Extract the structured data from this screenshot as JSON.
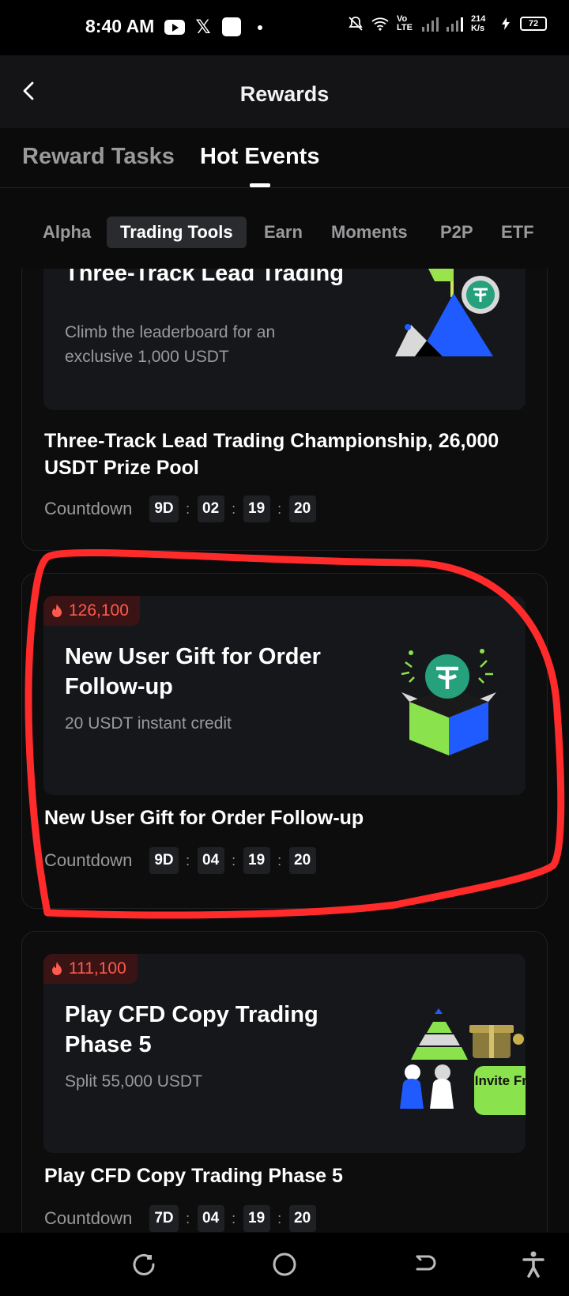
{
  "status_bar": {
    "time": "8:40 AM",
    "network": "Vo LTE",
    "speed": "214 K/s",
    "battery": "72"
  },
  "header": {
    "title": "Rewards"
  },
  "main_tabs": [
    {
      "label": "Reward Tasks",
      "active": false
    },
    {
      "label": "Hot Events",
      "active": true
    }
  ],
  "sub_tabs": [
    {
      "label": "Alpha",
      "active": false
    },
    {
      "label": "Trading Tools",
      "active": true
    },
    {
      "label": "Earn",
      "active": false
    },
    {
      "label": "Moments",
      "active": false
    },
    {
      "label": "P2P",
      "active": false
    },
    {
      "label": "ETF",
      "active": false
    }
  ],
  "events": [
    {
      "banner_title": "Three-Track Lead Trading",
      "banner_subtitle": "Climb the leaderboard for an exclusive 1,000 USDT",
      "title": "Three-Track Lead Trading Championship, 26,000 USDT Prize Pool",
      "countdown_label": "Countdown",
      "countdown": [
        "9D",
        "02",
        "19",
        "20"
      ]
    },
    {
      "participants": "126,100",
      "banner_title": "New User Gift for Order Follow-up",
      "banner_subtitle": "20 USDT instant credit",
      "title": "New User Gift for Order Follow-up",
      "countdown_label": "Countdown",
      "countdown": [
        "9D",
        "04",
        "19",
        "20"
      ]
    },
    {
      "participants": "111,100",
      "banner_title": "Play CFD Copy Trading Phase 5",
      "banner_subtitle": "Split 55,000 USDT",
      "invite_label": "Invite Friends",
      "title": "Play CFD Copy Trading Phase 5",
      "countdown_label": "Countdown",
      "countdown": [
        "7D",
        "04",
        "19",
        "20"
      ]
    }
  ],
  "colors": {
    "background": "#0b0b0c",
    "card": "#16171a",
    "accent_red": "#ff5a4f",
    "highlight_red": "#ff2a2a",
    "usdt_green": "#26a17b",
    "lime": "#8ae34c",
    "blue": "#1f5bff"
  },
  "nav": {
    "icons": [
      "recents-icon",
      "home-icon",
      "back-icon",
      "accessibility-icon"
    ]
  }
}
